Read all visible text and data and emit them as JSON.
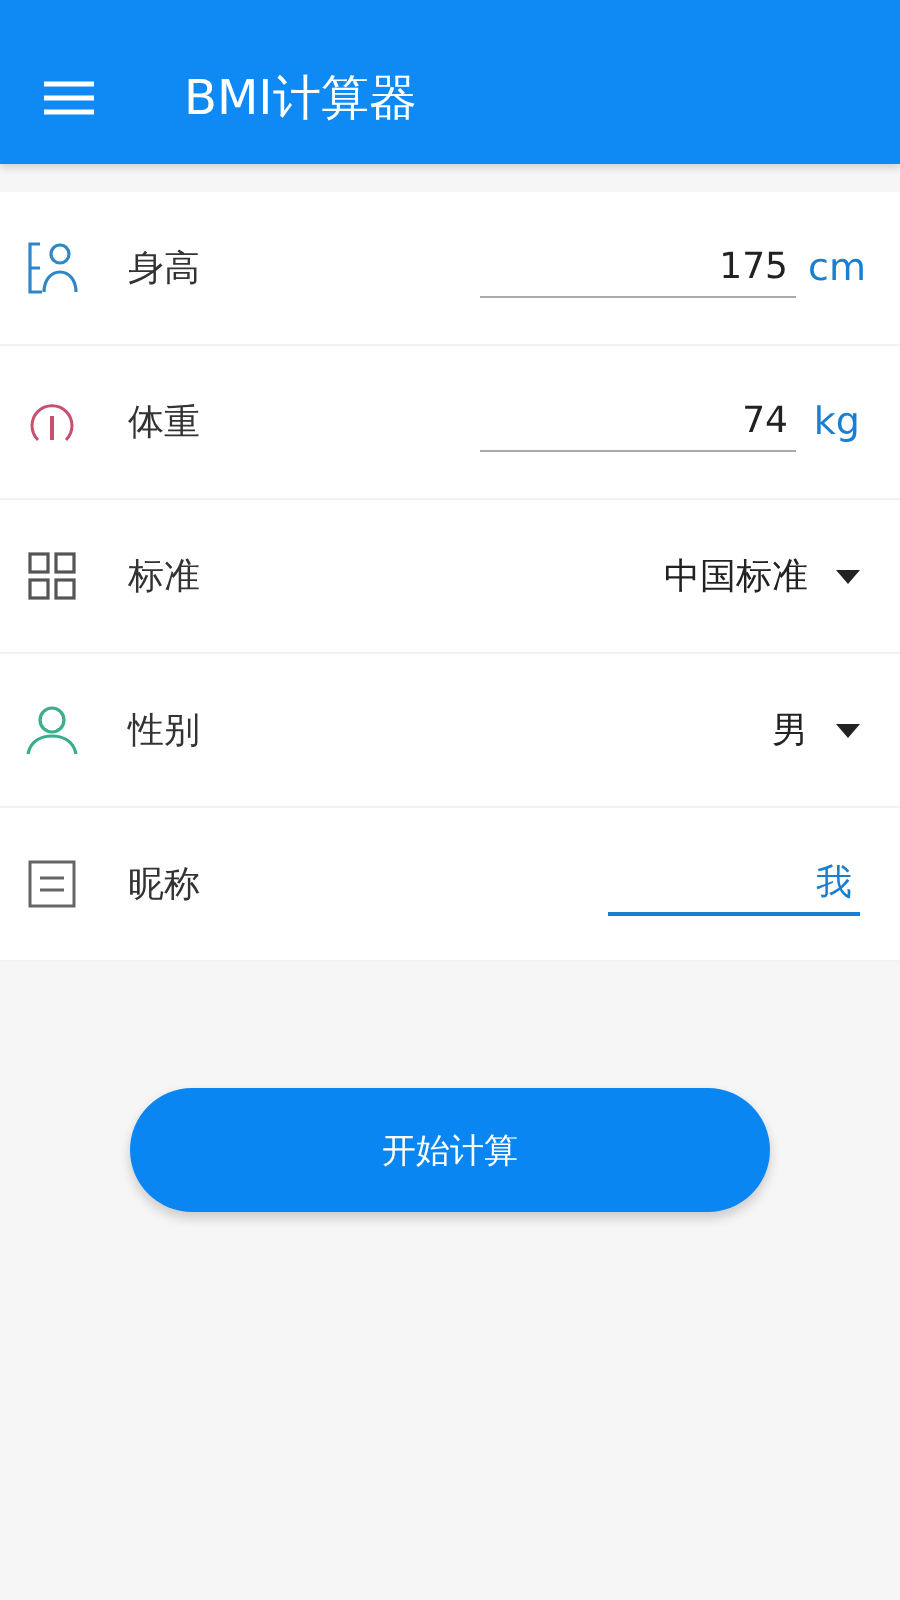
{
  "app_bar": {
    "title": "BMI计算器"
  },
  "fields": [
    {
      "kind": "input",
      "label": "身高",
      "value": "175",
      "unit": "cm",
      "focused": false
    },
    {
      "kind": "input",
      "label": "体重",
      "value": "74",
      "unit": "kg",
      "focused": false
    },
    {
      "kind": "select",
      "label": "标准",
      "value": "中国标准"
    },
    {
      "kind": "select",
      "label": "性别",
      "value": "男"
    },
    {
      "kind": "input",
      "label": "昵称",
      "value": "我",
      "focused": true
    }
  ],
  "button": {
    "label": "开始计算"
  }
}
